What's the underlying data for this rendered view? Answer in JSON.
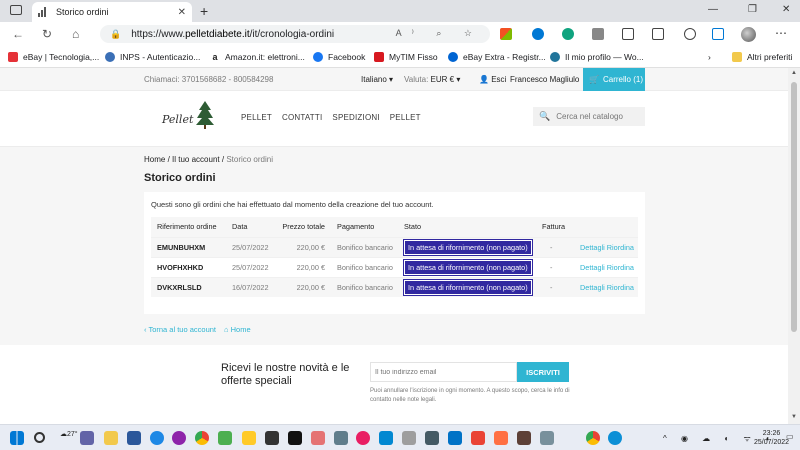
{
  "browser": {
    "tab_title": "Storico ordini",
    "url_prefix": "https://www.",
    "url_domain": "pelletdiabete.it",
    "url_path": "/it/cronologia-ordini",
    "bookmarks": [
      {
        "label": "eBay | Tecnologia,...",
        "color": "#e53238"
      },
      {
        "label": "INPS - Autenticazio...",
        "color": "#3b6fb6"
      },
      {
        "label": "Amazon.it: elettroni...",
        "color": "#222222"
      },
      {
        "label": "Facebook",
        "color": "#1877f2"
      },
      {
        "label": "MyTIM Fisso",
        "color": "#d71920"
      },
      {
        "label": "eBay Extra - Registr...",
        "color": "#0064d2"
      },
      {
        "label": "Il mio profilo — Wo...",
        "color": "#21759b"
      }
    ],
    "other_favorites": "Altri preferiti"
  },
  "site": {
    "contact": "Chiamaci: 3701568682 - 800584298",
    "language": "Italiano ▾",
    "currency_label": "Valuta:",
    "currency_value": "EUR € ▾",
    "logout": "Esci",
    "user_name": "Francesco Magliulo",
    "cart": "Carrello (1)",
    "logo_text": "Pellet",
    "menu": [
      "PELLET",
      "CONTATTI",
      "SPEDIZIONI",
      "PELLET"
    ],
    "search_placeholder": "Cerca nel catalogo"
  },
  "breadcrumb": [
    "Home",
    "Il tuo account",
    "Storico ordini"
  ],
  "page_title": "Storico ordini",
  "intro": "Questi sono gli ordini che hai effettuato dal momento della creazione del tuo account.",
  "table": {
    "headers": [
      "Riferimento ordine",
      "Data",
      "Prezzo totale",
      "Pagamento",
      "Stato",
      "Fattura",
      ""
    ],
    "rows": [
      {
        "ref": "EMUNBUHXM",
        "date": "25/07/2022",
        "total": "220,00 €",
        "payment": "Bonifico bancario",
        "status": "In attesa di rifornimento (non pagato)",
        "invoice": "-",
        "details": "Dettagli",
        "reorder": "Riordina"
      },
      {
        "ref": "HVOFHXHKD",
        "date": "25/07/2022",
        "total": "220,00 €",
        "payment": "Bonifico bancario",
        "status": "In attesa di rifornimento (non pagato)",
        "invoice": "-",
        "details": "Dettagli",
        "reorder": "Riordina"
      },
      {
        "ref": "DVKXRLSLD",
        "date": "16/07/2022",
        "total": "220,00 €",
        "payment": "Bonifico bancario",
        "status": "In attesa di rifornimento (non pagato)",
        "invoice": "-",
        "details": "Dettagli",
        "reorder": "Riordina"
      }
    ]
  },
  "footer_links": {
    "back": "‹ Torna al tuo account",
    "home": "⌂ Home"
  },
  "newsletter": {
    "title": "Ricevi le nostre novità e le offerte speciali",
    "placeholder": "Il tuo indirizzo email",
    "button": "ISCRIVITI",
    "note": "Puoi annullare l'iscrizione in ogni momento. A questo scopo, cerca le info di contatto nelle note legali."
  },
  "taskbar": {
    "weather": "27°",
    "time": "23:26",
    "date": "25/07/2022"
  },
  "colors": {
    "accent": "#2fb5d2",
    "status_badge": "#3128a0"
  }
}
